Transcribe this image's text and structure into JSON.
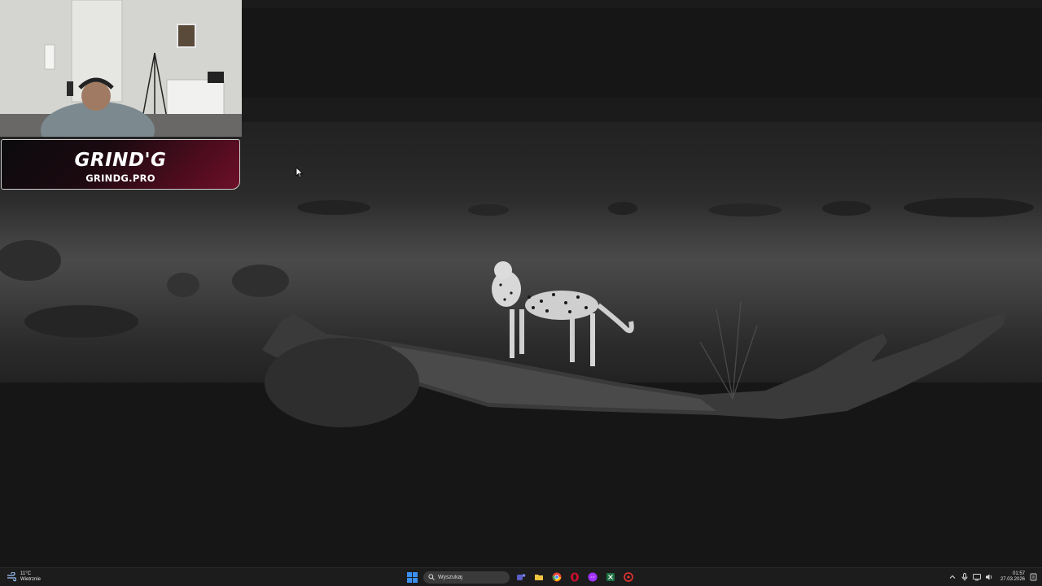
{
  "overlay": {
    "brand_logo_text": "GRIND'G",
    "brand_url": "GRINDG.PRO"
  },
  "taskbar": {
    "weather": {
      "temperature": "11°C",
      "condition": "Wietrznie",
      "icon": "windy-weather-icon"
    },
    "search": {
      "placeholder": "Wyszukaj"
    },
    "pinned_apps": [
      {
        "name": "start",
        "icon": "windows-logo-icon"
      },
      {
        "name": "teams",
        "icon": "teams-icon"
      },
      {
        "name": "file-explorer",
        "icon": "folder-icon"
      },
      {
        "name": "chrome",
        "icon": "chrome-icon"
      },
      {
        "name": "opera",
        "icon": "opera-icon"
      },
      {
        "name": "messenger",
        "icon": "messenger-icon"
      },
      {
        "name": "excel",
        "icon": "excel-icon"
      },
      {
        "name": "app-red",
        "icon": "red-app-icon"
      }
    ],
    "tray": {
      "time": "01:57",
      "date": "27.03.2026"
    }
  },
  "colors": {
    "taskbar_bg": "#1c1c1c",
    "brand_accent": "#6d1028",
    "windows_blue": "#3b8ff0"
  }
}
